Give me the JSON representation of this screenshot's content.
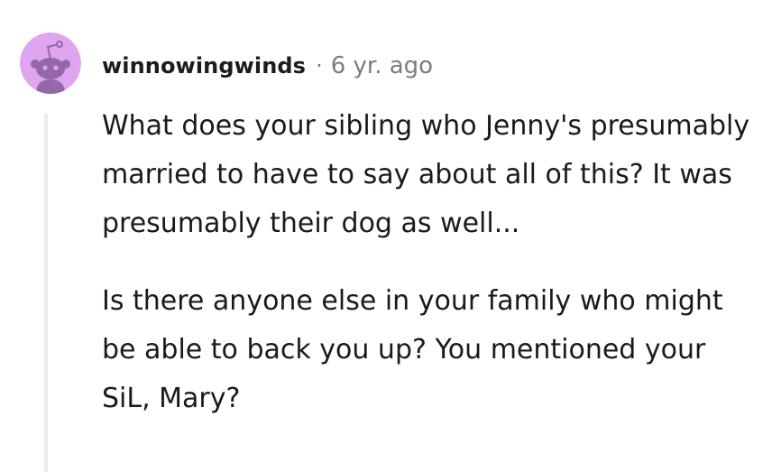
{
  "comment": {
    "author": "winnowingwinds",
    "separator": "·",
    "timestamp": "6 yr. ago",
    "paragraphs": [
      "What does your sibling who Jenny's presumably married to have to say about all of this? It was presumably their dog as well...",
      "Is there anyone else in your family who might be able to back you up? You mentioned your SiL, Mary?"
    ]
  },
  "avatar": {
    "icon": "reddit-snoo-avatar-icon",
    "background_color": "#e0a5f0",
    "figure_color": "#9468a8"
  }
}
